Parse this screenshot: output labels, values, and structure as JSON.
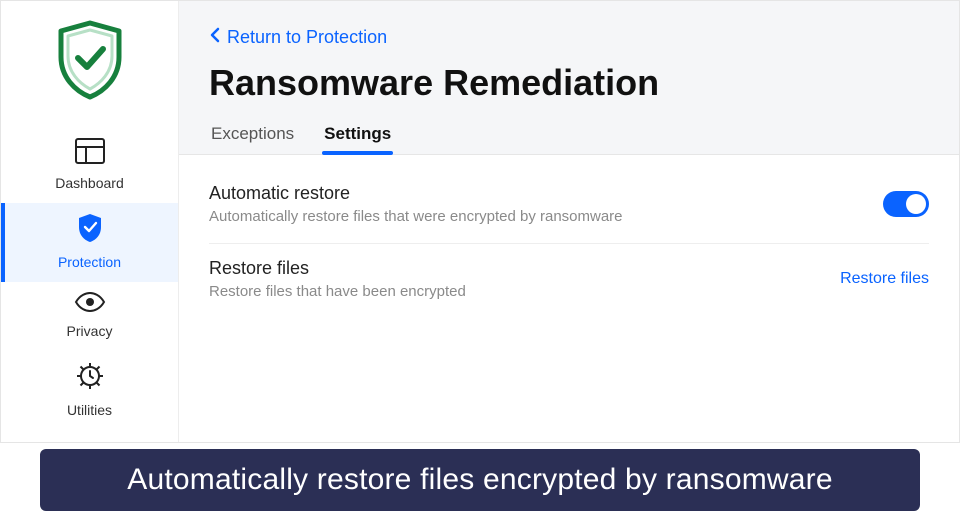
{
  "sidebar": {
    "items": [
      {
        "label": "Dashboard"
      },
      {
        "label": "Protection"
      },
      {
        "label": "Privacy"
      },
      {
        "label": "Utilities"
      }
    ]
  },
  "header": {
    "back_label": "Return to Protection",
    "title": "Ransomware Remediation",
    "tabs": [
      {
        "label": "Exceptions"
      },
      {
        "label": "Settings"
      }
    ]
  },
  "settings": {
    "auto_restore": {
      "title": "Automatic restore",
      "desc": "Automatically restore files that were encrypted by ransomware",
      "enabled": true
    },
    "restore_files": {
      "title": "Restore files",
      "desc": "Restore files that have been encrypted",
      "action_label": "Restore files"
    }
  },
  "caption": "Automatically restore files encrypted by ransomware"
}
